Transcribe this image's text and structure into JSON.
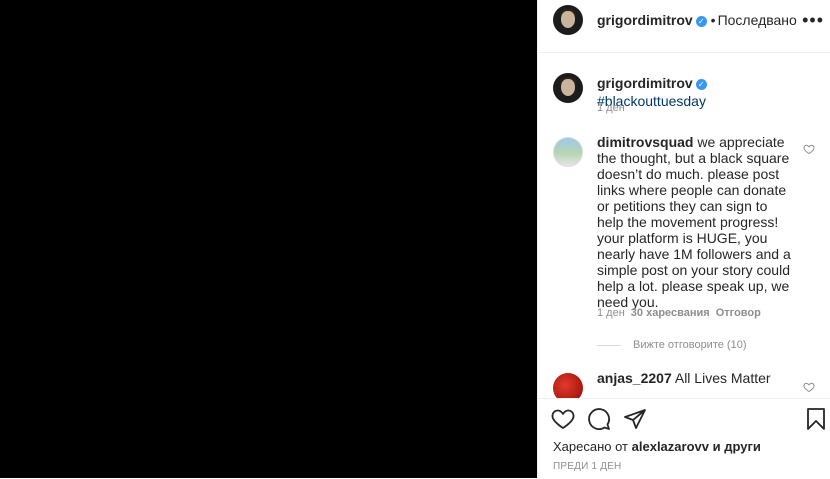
{
  "post": {
    "owner": "grigordimitrov",
    "verified_mark": "✓",
    "separator": "•",
    "follow_status": "Последвано",
    "more_symbol": "•••"
  },
  "caption": {
    "username": "grigordimitrov",
    "text": "#blackouttuesday",
    "time": "1 ден"
  },
  "comments": [
    {
      "username": "dimitrovsquad",
      "text": "we appreciate the thought, but a black square doesn’t do much. please post links where people can donate or petitions they can sign to help the movement progress! your platform is HUGE, you nearly have 1M followers and a simple post on your story could help a lot. please speak up, we need you.",
      "time": "1 ден",
      "likes": "30 харесвания",
      "reply_label": "Отговор",
      "view_replies": "Вижте отговорите (10)"
    },
    {
      "username": "anjas_2207",
      "text": "All Lives Matter"
    }
  ],
  "actions": {
    "liked_by_prefix": "Харесано от",
    "liked_by_user": "alexlazarovv",
    "liked_by_suffix": "и други",
    "date": "ПРЕДИ 1 ДЕН"
  },
  "icons": {
    "heart": "heart-icon",
    "comment": "comment-icon",
    "share": "share-icon",
    "bookmark": "bookmark-icon",
    "verified": "verified-badge-icon"
  },
  "colors": {
    "media_background": "#000000",
    "verified": "#3897f0",
    "hashtag": "#00376b",
    "meta": "#8e8e8e"
  }
}
